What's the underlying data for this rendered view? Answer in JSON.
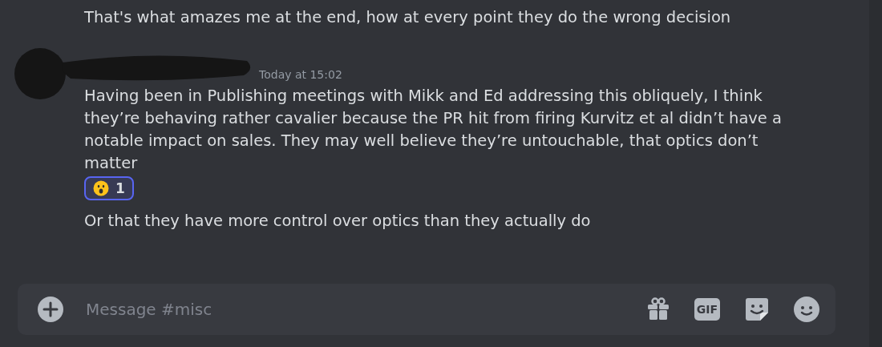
{
  "messages": [
    {
      "kind": "continuation",
      "text": "That's what amazes me at the end, how at every point they do the wrong decision"
    },
    {
      "kind": "header",
      "redacted": true,
      "timestamp": "Today at 15:02",
      "text": "Having been in Publishing meetings with Mikk and Ed addressing this obliquely, I think they’re behaving rather cavalier because the PR hit from firing Kurvitz et al didn’t have a notable impact on sales. They may well believe they’re untouchable, that optics don’t matter",
      "reactions": [
        {
          "count": "1",
          "selected": true
        }
      ]
    },
    {
      "kind": "continuation",
      "text": "Or that they have more control over optics than they actually do"
    }
  ],
  "composer": {
    "placeholder": "Message #misc",
    "gif_label": "GIF"
  }
}
